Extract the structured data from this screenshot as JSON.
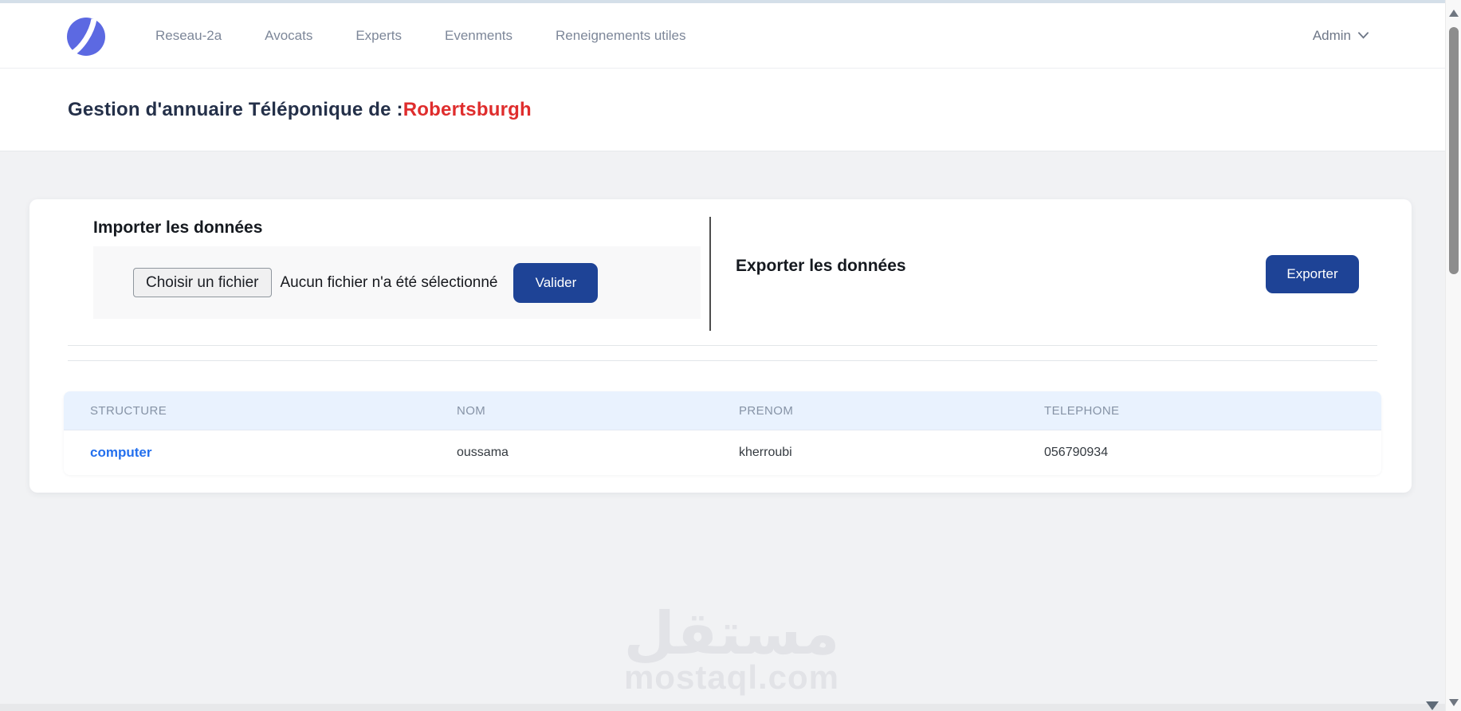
{
  "navbar": {
    "brand_icon": "swoosh-circle-logo",
    "items": [
      "Reseau-2a",
      "Avocats",
      "Experts",
      "Evenments",
      "Reneignements utiles"
    ],
    "user_menu": {
      "label": "Admin"
    }
  },
  "page_header": {
    "title_prefix": "Gestion d'annuaire Téléponique de :",
    "title_highlight": "Robertsburgh"
  },
  "import_section": {
    "heading": "Importer les données",
    "file_button_label": "Choisir un fichier",
    "file_status": "Aucun fichier n'a été sélectionné",
    "submit_label": "Valider"
  },
  "export_section": {
    "heading": "Exporter les données",
    "button_label": "Exporter"
  },
  "table": {
    "headers": [
      "STRUCTURE",
      "NOM",
      "PRENOM",
      "TELEPHONE"
    ],
    "rows": [
      {
        "structure": "computer",
        "nom": "oussama",
        "prenom": "kherroubi",
        "telephone": "056790934"
      }
    ]
  },
  "watermark": {
    "arabic": "مستقل",
    "latin": "mostaql.com"
  },
  "colors": {
    "brand_blue": "#5c69e2",
    "button_blue": "#1e4396",
    "link_blue": "#2470ee",
    "title_navy": "#243049",
    "title_red": "#df2d2d",
    "table_header_bg": "#e9f2fe",
    "page_bg": "#f1f2f4"
  }
}
